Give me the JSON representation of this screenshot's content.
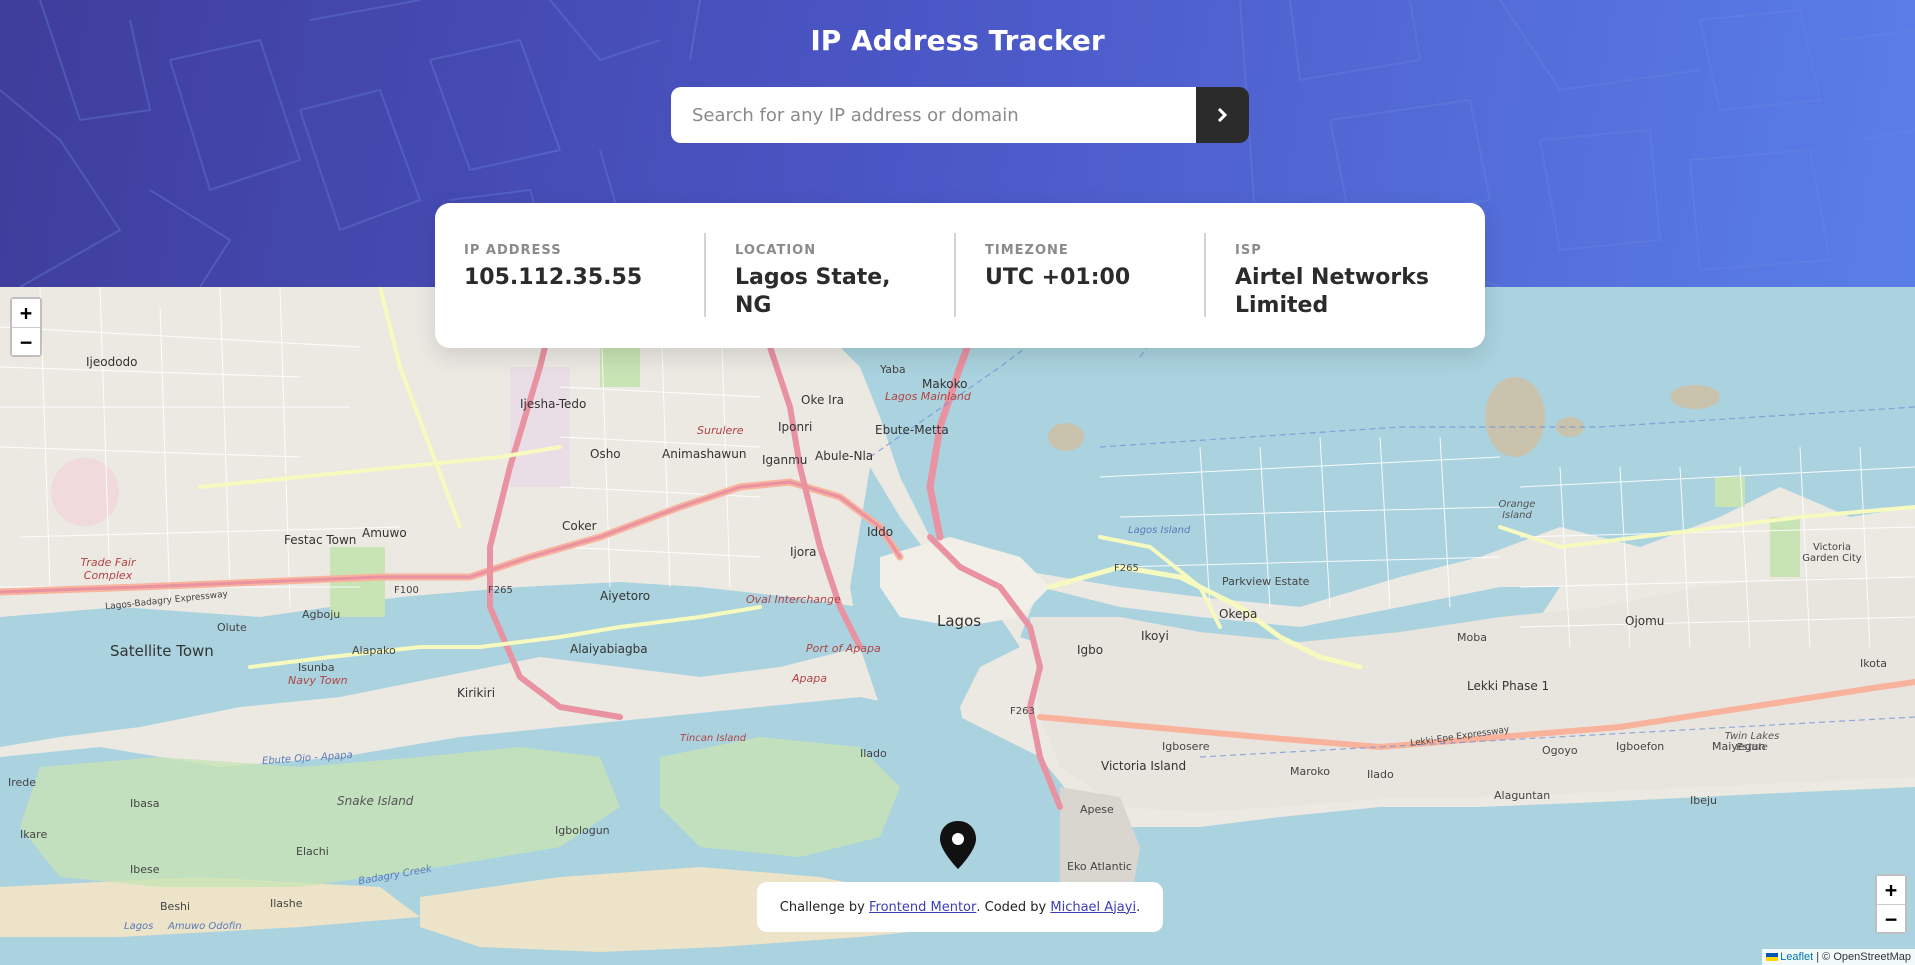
{
  "header": {
    "title": "IP Address Tracker",
    "search_placeholder": "Search for any IP address or domain",
    "search_value": "",
    "submit_icon": "chevron-right-icon"
  },
  "info": [
    {
      "label": "IP ADDRESS",
      "value": "105.112.35.55"
    },
    {
      "label": "LOCATION",
      "value": "Lagos State, NG"
    },
    {
      "label": "TIMEZONE",
      "value": "UTC +01:00"
    },
    {
      "label": "ISP",
      "value": "Airtel Networks Limited"
    }
  ],
  "map": {
    "zoom_in": "+",
    "zoom_out": "−",
    "marker_icon": "location-pin-icon",
    "labels": {
      "lagos": "Lagos",
      "ijeododo": "Ijeododo",
      "ijesha_tedo": "Ijesha-Tedo",
      "oke_ira": "Oke Ira",
      "yaba": "Yaba",
      "makoko": "Makoko",
      "lagos_mainland": "Lagos Mainland",
      "ebute_metta": "Ebute-Metta",
      "surulere": "Surulere",
      "iponri": "Iponri",
      "oshodi": "Osho",
      "animashawun": "Animashawun",
      "iganmu": "Iganmu",
      "abule_nla": "Abule-Nla",
      "amuwo": "Amuwo",
      "festac_town": "Festac Town",
      "coker": "Coker",
      "iddo": "Iddo",
      "ijora": "Ijora",
      "trade_fair_complex": "Trade Fair Complex",
      "agboju": "Agboju",
      "olute": "Olute",
      "aiyetoro": "Aiyetoro",
      "oval_interchange": "Oval Interchange",
      "satellite_town": "Satellite Town",
      "alapako": "Alapako",
      "isunba": "Isunba",
      "navy_town": "Navy Town",
      "kirikiri": "Kirikiri",
      "alaiyabiagba": "Alaiyabiagba",
      "port_of_apapa": "Port of Apapa",
      "apapa": "Apapa",
      "ikoyi": "Ikoyi",
      "igbo": "Igbo",
      "okepa": "Okepa",
      "parkview_estate": "Parkview Estate",
      "moba": "Moba",
      "ojomu": "Ojomu",
      "ikota": "Ikota",
      "victoria_garden_city": "Victoria Garden City",
      "orange_island": "Orange Island",
      "lagos_island": "Lagos Island",
      "lekki_phase_1": "Lekki Phase 1",
      "ogoyo": "Ogoyo",
      "igboefon": "Igboefon",
      "maiyegun": "Maiyegun",
      "twin_lakes_estate": "Twin Lakes Estate",
      "victoria_island": "Victoria Island",
      "igbosere": "Igbosere",
      "maroko": "Maroko",
      "ilado": "Ilado",
      "alaguntan": "Alaguntan",
      "ibeju": "Ibeju",
      "apese": "Apese",
      "eko_atlantic": "Eko Atlantic",
      "irede": "Irede",
      "ibasa": "Ibasa",
      "ikare": "Ikare",
      "ibese": "Ibese",
      "snake_island": "Snake Island",
      "elachi": "Elachi",
      "igbologun": "Igbologun",
      "tincan_island": "Tincan Island",
      "ilado2": "Ilado",
      "beshi": "Beshi",
      "ilashe": "Ilashe",
      "lagos_bottom": "Lagos",
      "amuwo_odofin": "Amuwo Odofin",
      "f100": "F100",
      "f265": "F265",
      "f265b": "F265",
      "f263": "F263",
      "lagos_badagry_expressway": "Lagos-Badagry Expressway",
      "ebute_ojo_apapa": "Ebute Ojo - Apapa",
      "badagry_creek": "Badagry Creek",
      "lekki_epe_expressway": "Lekki-Epe Expressway"
    }
  },
  "footer": {
    "prefix": "Challenge by ",
    "link1": "Frontend Mentor",
    "middle": ". Coded by ",
    "link2": "Michael Ajayi",
    "suffix": "."
  },
  "attribution": {
    "leaflet": "Leaflet",
    "sep": " | © ",
    "osm": "OpenStreetMap"
  },
  "colors": {
    "hero_start": "#3f3d9b",
    "hero_end": "#5a7ee8",
    "dark": "#2b2b2b",
    "water": "#aad3df",
    "road_major": "#e892a2",
    "road_secondary": "#f7fabf",
    "road_trunk": "#f9b29c",
    "park": "#c8e4b5"
  }
}
